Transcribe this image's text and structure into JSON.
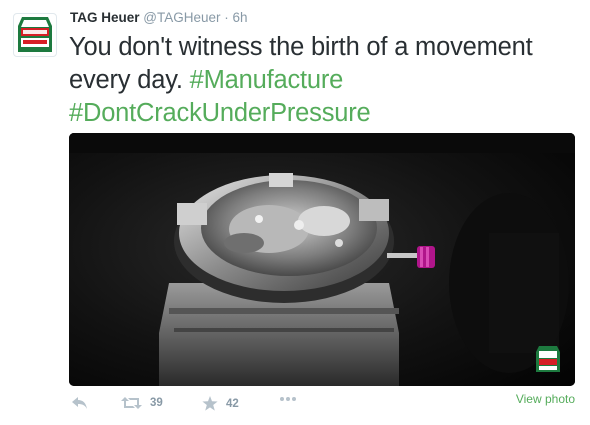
{
  "author": {
    "name": "TAG Heuer",
    "handle": "@TAGHeuer",
    "separator": "·",
    "time": "6h",
    "avatar_icon": "tag-heuer-logo-icon"
  },
  "tweet": {
    "text_before": "You don't witness the birth of a movement every day. ",
    "hashtag1": "#Manufacture",
    "hashtag2": "#DontCrackUnderPressure"
  },
  "media": {
    "alt": "Watch movement on an assembly stand",
    "watermark_icon": "tag-heuer-logo-icon"
  },
  "actions": {
    "reply_icon": "reply-icon",
    "retweet_icon": "retweet-icon",
    "retweet_count": "39",
    "favorite_icon": "star-icon",
    "favorite_count": "42",
    "more_icon": "more-icon",
    "view_photo": "View photo"
  },
  "colors": {
    "hashtag": "#55ac5b",
    "text": "#292f33",
    "muted": "#8899a6",
    "brand_red": "#d61f26",
    "brand_green": "#1d7a3f"
  }
}
